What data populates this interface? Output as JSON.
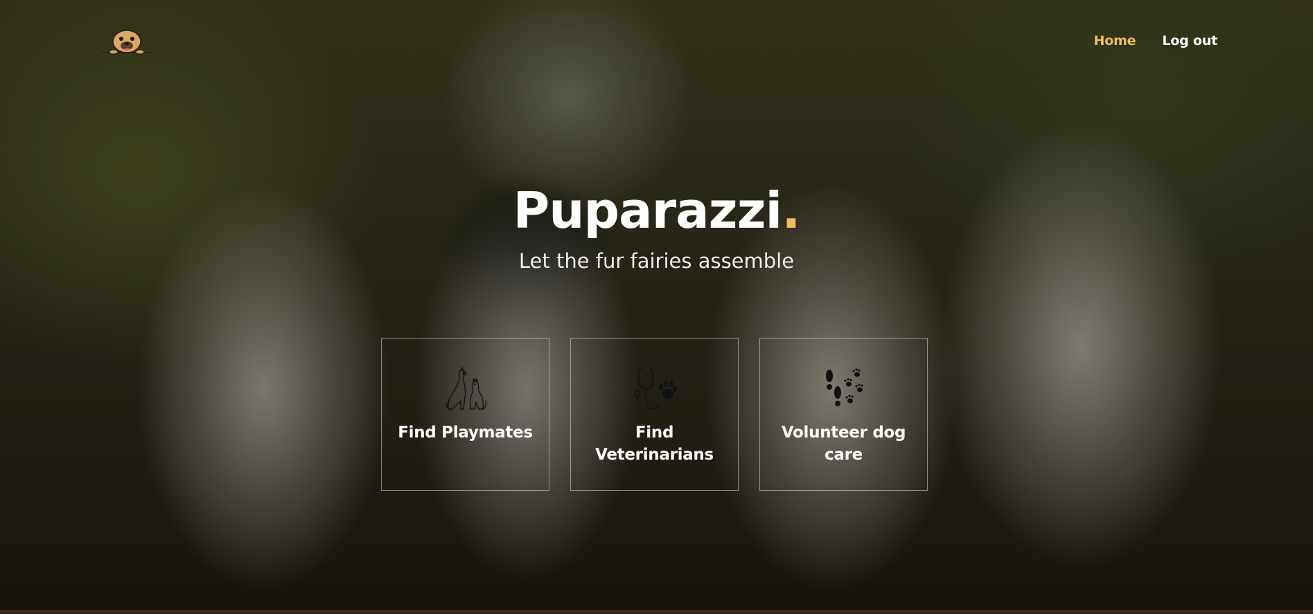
{
  "nav": {
    "logo_icon": "pug-dog-logo-icon",
    "items": [
      {
        "label": "Home",
        "active": true
      },
      {
        "label": "Log out",
        "active": false
      }
    ]
  },
  "hero": {
    "title": "Puparazzi",
    "title_dot": ".",
    "subtitle": "Let the fur fairies assemble"
  },
  "cards": [
    {
      "label": "Find Playmates",
      "icon": "dogs-icon"
    },
    {
      "label": "Find Veterinarians",
      "icon": "stethoscope-paw-icon"
    },
    {
      "label": "Volunteer dog care",
      "icon": "footprints-paws-icon"
    }
  ],
  "colors": {
    "accent": "#f0bb5a",
    "text": "#ffffff"
  }
}
